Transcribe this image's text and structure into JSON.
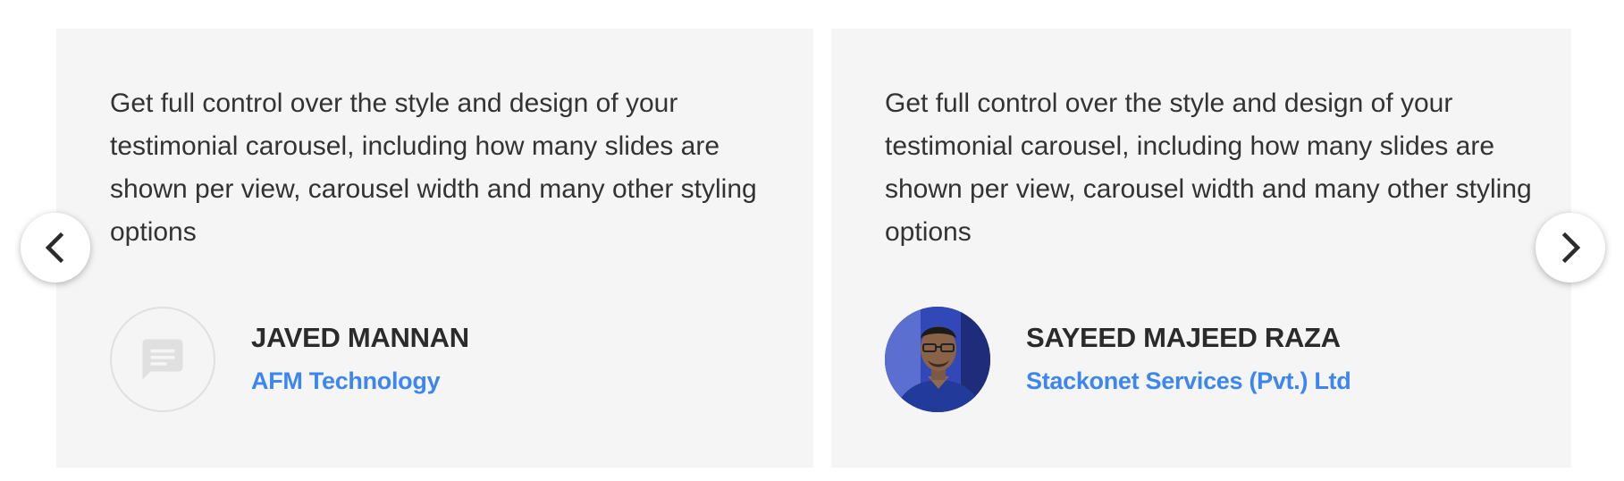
{
  "carousel": {
    "prev_icon": "chevron-left-icon",
    "next_icon": "chevron-right-icon",
    "slides": [
      {
        "quote": "Get full control over the style and design of your testimonial carousel, including how many slides are shown per view, carousel width and many other styling options",
        "author_name": "JAVED MANNAN",
        "company": "AFM Technology",
        "avatar": "message-icon"
      },
      {
        "quote": "Get full control over the style and design of your testimonial carousel, including how many slides are shown per view, carousel width and many other styling options",
        "author_name": "SAYEED MAJEED RAZA",
        "company": "Stackonet Services (Pvt.) Ltd",
        "avatar": "author-photo"
      }
    ]
  },
  "colors": {
    "card_bg": "#f5f5f5",
    "text": "#333333",
    "name": "#2b2b2b",
    "company_link": "#3b86f0"
  }
}
